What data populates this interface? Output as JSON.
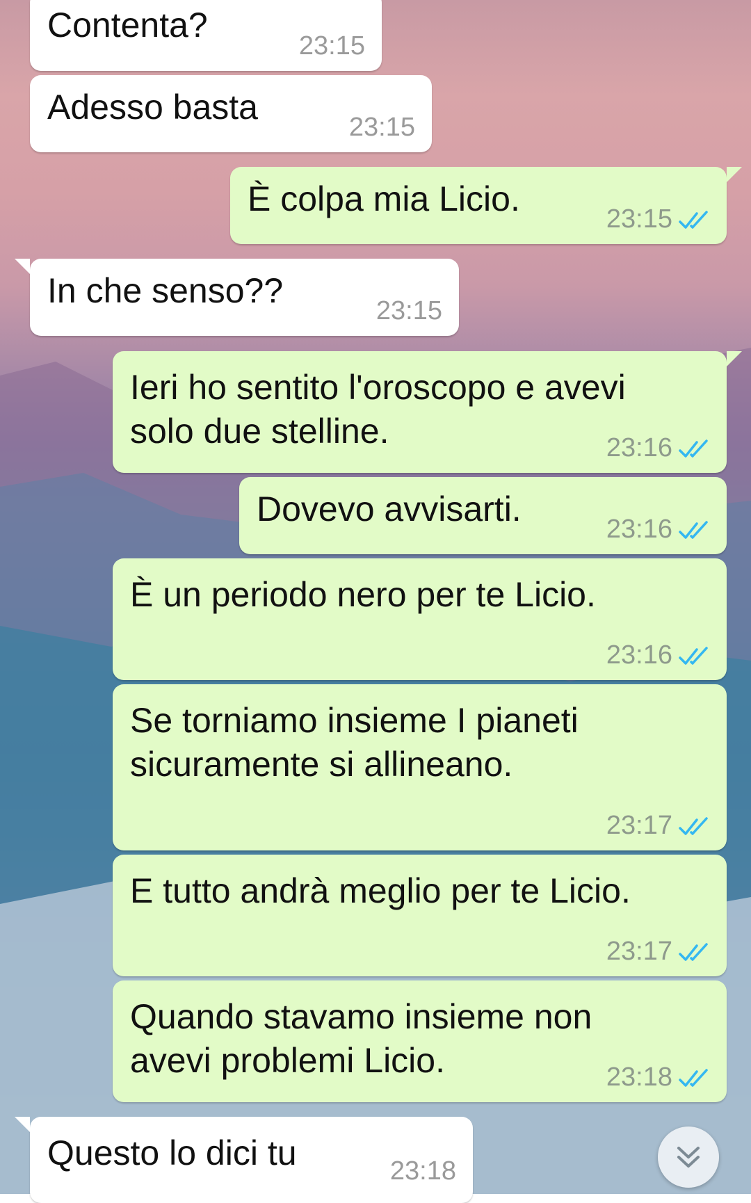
{
  "chat": {
    "messages": [
      {
        "direction": "in",
        "text": "Contenta?",
        "time": "23:15"
      },
      {
        "direction": "in",
        "text": "Adesso basta",
        "time": "23:15"
      },
      {
        "direction": "out",
        "text": "È colpa mia Licio.",
        "time": "23:15",
        "status": "read"
      },
      {
        "direction": "in",
        "text": "In che senso??",
        "time": "23:15"
      },
      {
        "direction": "out",
        "text": "Ieri ho sentito l'oroscopo e avevi solo due stelline.",
        "lines": [
          "Ieri ho sentito l'oroscopo e avevi",
          "solo due stelline."
        ],
        "time": "23:16",
        "status": "read"
      },
      {
        "direction": "out",
        "text": "Dovevo avvisarti.",
        "time": "23:16",
        "status": "read"
      },
      {
        "direction": "out",
        "text": "È un periodo nero per te Licio.",
        "time": "23:16",
        "status": "read"
      },
      {
        "direction": "out",
        "text": "Se torniamo insieme I pianeti sicuramente si allineano.",
        "lines": [
          "Se torniamo insieme I pianeti",
          "sicuramente si allineano."
        ],
        "time": "23:17",
        "status": "read"
      },
      {
        "direction": "out",
        "text": "E tutto andrà meglio per te Licio.",
        "time": "23:17",
        "status": "read"
      },
      {
        "direction": "out",
        "text": "Quando stavamo insieme non avevi problemi Licio.",
        "lines": [
          "Quando stavamo insieme non",
          "avevi problemi Licio."
        ],
        "time": "23:18",
        "status": "read"
      },
      {
        "direction": "in",
        "text": "Questo lo dici tu",
        "time": "23:18"
      }
    ]
  },
  "icons": {
    "read_receipt": "double-check-icon",
    "scroll_down": "chevron-double-down-icon"
  },
  "colors": {
    "incoming_bubble": "#ffffff",
    "outgoing_bubble": "#e2fbc7",
    "read_tick": "#34b7f1",
    "timestamp": "#8e9a8c"
  }
}
